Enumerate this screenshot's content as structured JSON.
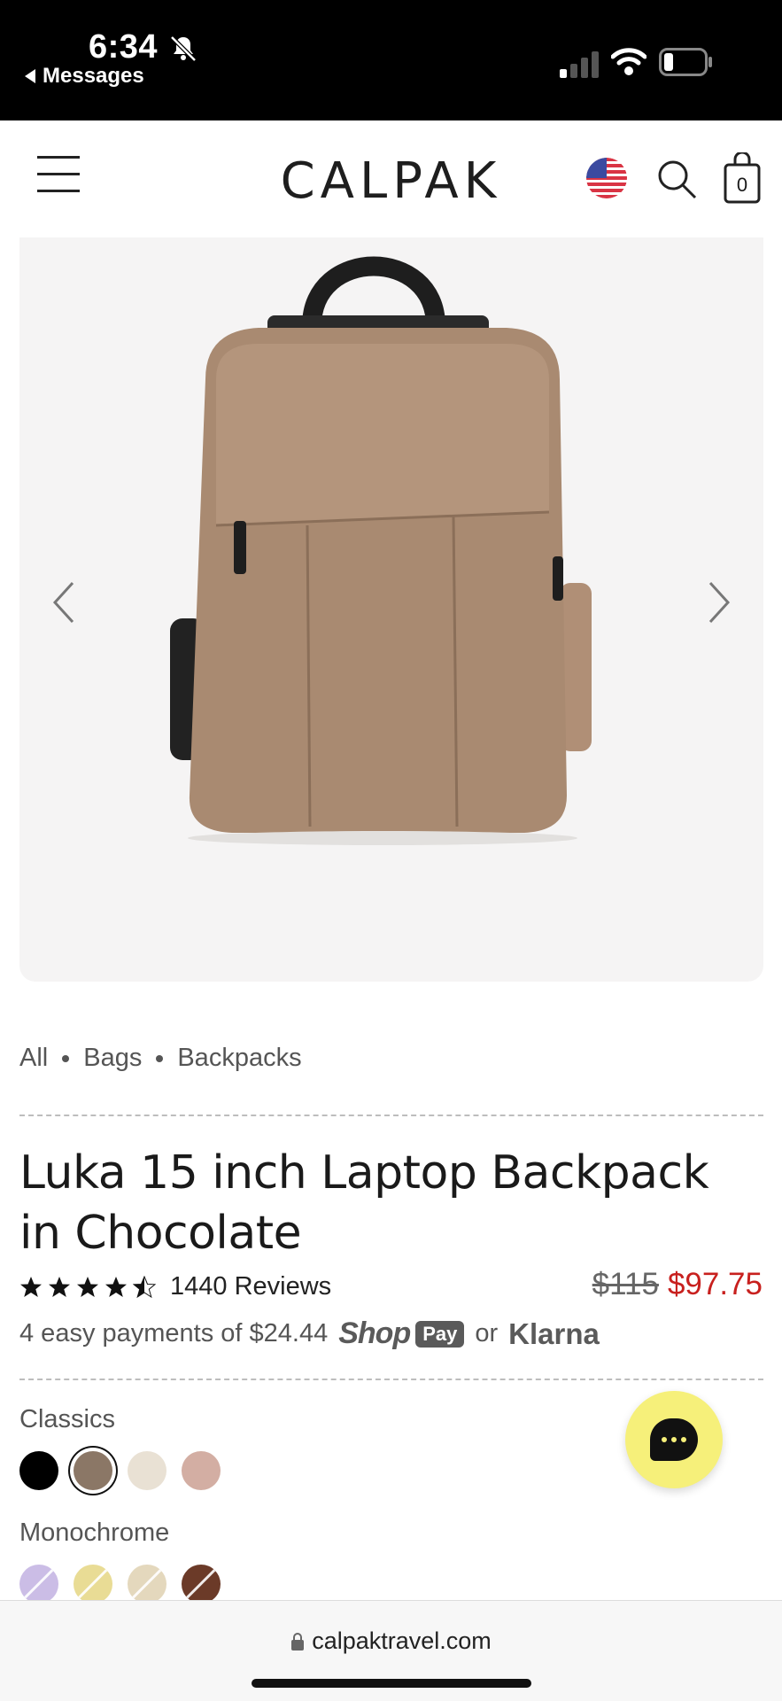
{
  "status_bar": {
    "time": "6:34",
    "back_app": "Messages",
    "icons": [
      "bell-slash-icon",
      "signal-icon",
      "wifi-icon",
      "battery-icon"
    ]
  },
  "header": {
    "logo": "CALPAK",
    "cart_count": "0",
    "icons": [
      "menu-icon",
      "us-flag-icon",
      "search-icon",
      "cart-icon"
    ]
  },
  "gallery": {
    "icons": [
      "chevron-left-icon",
      "chevron-right-icon"
    ]
  },
  "breadcrumb": [
    "All",
    "Bags",
    "Backpacks"
  ],
  "product": {
    "title": "Luka 15 inch Laptop Backpack in Chocolate",
    "rating": 4.5,
    "reviews": "1440 Reviews",
    "price_old": "$115",
    "price_new": "$97.75",
    "installments": "4 easy payments of $24.44",
    "shop_word": "Shop",
    "pay_word": "Pay",
    "or": "or",
    "klarna": "Klarna"
  },
  "colors": {
    "accent_sale": "#c8201e",
    "chat": "#f6f07a"
  },
  "color_groups": [
    {
      "label": "Classics",
      "swatches": [
        "#000000",
        "#8b7766",
        "#e9e1d4",
        "#d3aea3"
      ],
      "selected": 1
    },
    {
      "label": "Monochrome",
      "swatches": [
        "#cbbde6",
        "#e9dc95",
        "#e4d8bd",
        "#6b3a28"
      ]
    }
  ],
  "browser": {
    "url": "calpaktravel.com"
  }
}
